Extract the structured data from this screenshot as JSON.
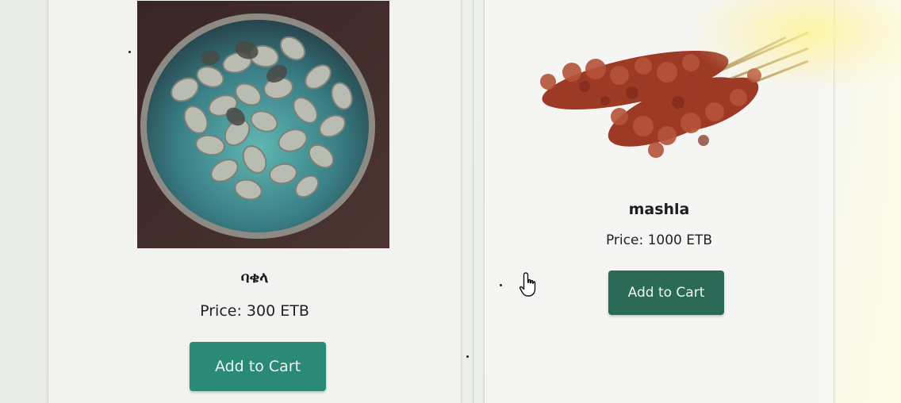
{
  "products": [
    {
      "name": "ባቄላ",
      "price": "Price: 300 ETB",
      "button_label": "Add to Cart",
      "image": "faba-beans-bowl",
      "button_color": "#2a8a76"
    },
    {
      "name": "mashla",
      "price": "Price: 1000 ETB",
      "button_label": "Add to Cart",
      "image": "sorghum-stalks",
      "button_color": "#2a6a57"
    }
  ],
  "cursor": {
    "icon": "hand-pointer-icon"
  },
  "colors": {
    "accent": "#2a8a76",
    "accent_dark": "#2a6a57",
    "background": "#eceee9"
  }
}
